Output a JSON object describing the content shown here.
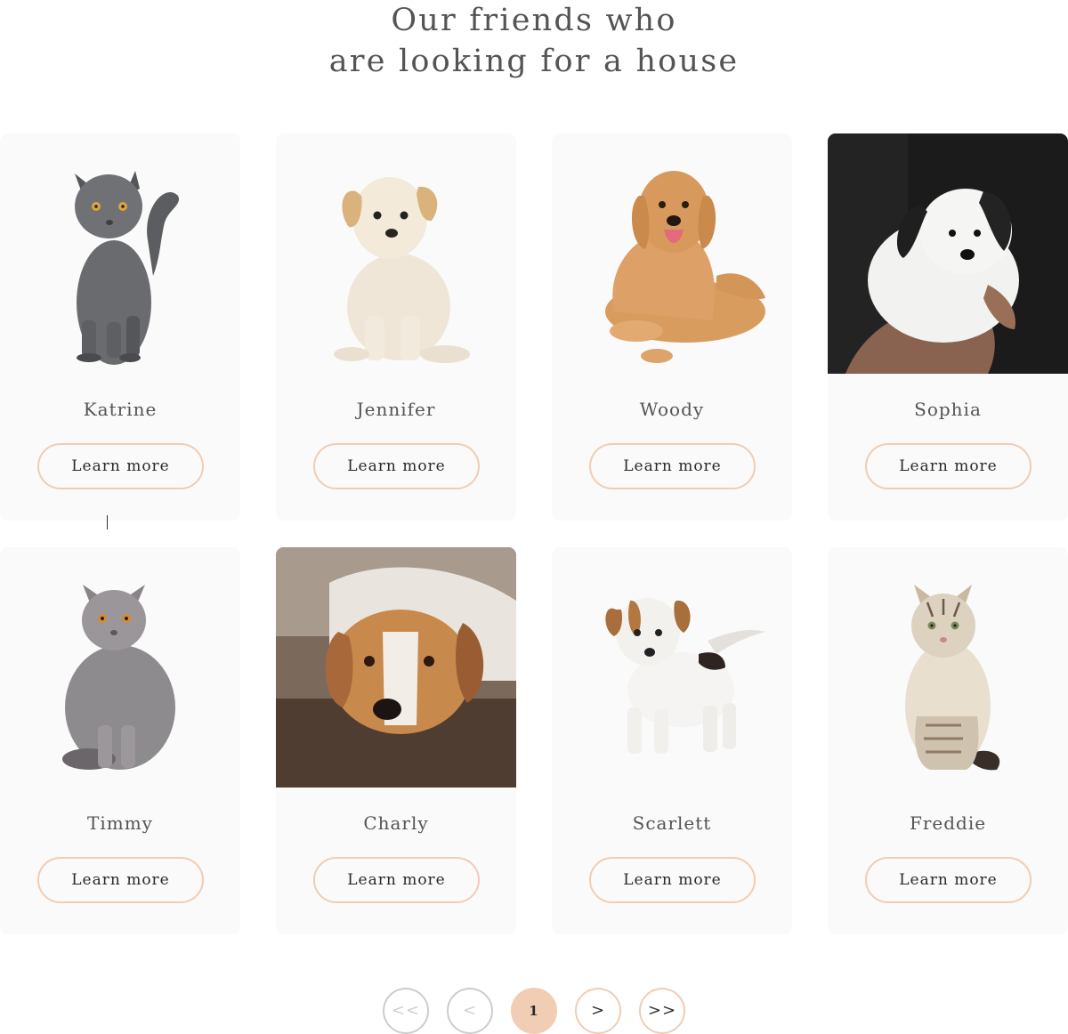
{
  "heading": {
    "line1": "Our friends who",
    "line2": "are looking for a house"
  },
  "pets": [
    {
      "name": "Katrine",
      "button": "Learn more",
      "icon": "gray-cat-photo"
    },
    {
      "name": "Jennifer",
      "button": "Learn more",
      "icon": "cream-puppy-photo"
    },
    {
      "name": "Woody",
      "button": "Learn more",
      "icon": "golden-retriever-photo"
    },
    {
      "name": "Sophia",
      "button": "Learn more",
      "icon": "white-puppy-photo"
    },
    {
      "name": "Timmy",
      "button": "Learn more",
      "icon": "british-shorthair-cat-photo"
    },
    {
      "name": "Charly",
      "button": "Learn more",
      "icon": "lying-dog-photo"
    },
    {
      "name": "Scarlett",
      "button": "Learn more",
      "icon": "jack-russell-puppy-photo"
    },
    {
      "name": "Freddie",
      "button": "Learn more",
      "icon": "tabby-cat-photo"
    }
  ],
  "pagination": {
    "first": "<<",
    "prev": "<",
    "current": "1",
    "next": ">",
    "last": ">>"
  },
  "colors": {
    "accent": "#f1cdb3",
    "card_bg": "#fafafa",
    "disabled": "#cdcdcd",
    "text": "#545454"
  }
}
